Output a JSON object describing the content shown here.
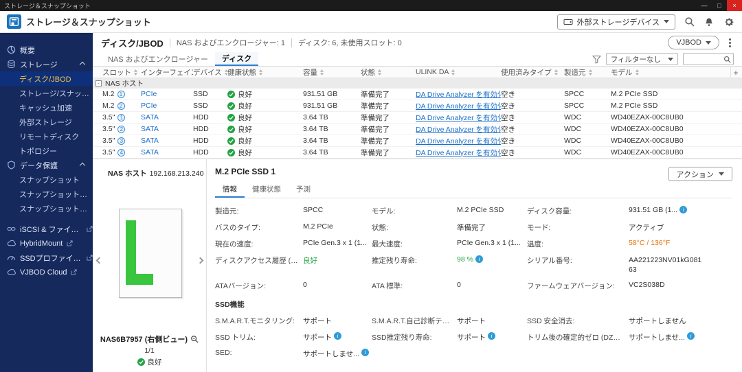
{
  "colors": {
    "titlebar_bg": "#1b1b1b",
    "sidebar_bg": "#16295c",
    "selected_item_text": "#f6c436",
    "accent_blue": "#2b7fd0",
    "link_blue": "#1a6fc9",
    "good_green": "#21a344",
    "temp_orange": "#e8700a",
    "close_red": "#d8231f"
  },
  "titlebar": {
    "title": "ストレージ＆スナップショット",
    "minimize": "—",
    "maximize": "□",
    "close": "×"
  },
  "header": {
    "title": "ストレージ＆スナップショット",
    "external_device_button": "外部ストレージデバイス"
  },
  "sidebar": {
    "overview": "概要",
    "storage_section": "ストレージ",
    "storage_items": [
      "ディスク/JBOD",
      "ストレージ/スナップショ...",
      "キャッシュ加速",
      "外部ストレージ",
      "リモートディスク",
      "トポロジー"
    ],
    "protection_section": "データ保護",
    "protection_items": [
      "スナップショット",
      "スナップショットレプリカ",
      "スナップショットボールト"
    ],
    "external_items": [
      "iSCSI & ファイバー...",
      "HybridMount",
      "SSDプロファイリング...",
      "VJBOD Cloud"
    ]
  },
  "page": {
    "title": "ディスク/JBOD",
    "summary_enclosure": "NAS およびエンクロージャー: 1",
    "summary_disks": "ディスク: 6, 未使用スロット: 0",
    "vjbod_button": "VJBOD"
  },
  "tabs": {
    "enclosure": "NAS およびエンクロージャー",
    "disk": "ディスク",
    "filter": "フィルターなし",
    "add_column": "+"
  },
  "table": {
    "columns": [
      "スロット",
      "インターフェイス",
      "デバイス",
      "健康状態",
      "容量",
      "状態",
      "ULINK DA",
      "使用済みタイプ",
      "製造元",
      "モデル"
    ],
    "group": "NAS ホスト",
    "rows": [
      {
        "slot_type": "M.2",
        "slot_num": "1",
        "iface": "PCIe",
        "device": "SSD",
        "health": "良好",
        "capacity": "931.51 GB",
        "status": "準備完了",
        "ulink": "DA Drive Analyzer を有効化",
        "used": "空き",
        "vendor": "SPCC",
        "model": "M.2 PCIe SSD"
      },
      {
        "slot_type": "M.2",
        "slot_num": "2",
        "iface": "PCIe",
        "device": "SSD",
        "health": "良好",
        "capacity": "931.51 GB",
        "status": "準備完了",
        "ulink": "DA Drive Analyzer を有効化",
        "used": "空き",
        "vendor": "SPCC",
        "model": "M.2 PCIe SSD"
      },
      {
        "slot_type": "3.5\"",
        "slot_num": "1",
        "iface": "SATA",
        "device": "HDD",
        "health": "良好",
        "capacity": "3.64 TB",
        "status": "準備完了",
        "ulink": "DA Drive Analyzer を有効化",
        "used": "空き",
        "vendor": "WDC",
        "model": "WD40EZAX-00C8UB0"
      },
      {
        "slot_type": "3.5\"",
        "slot_num": "2",
        "iface": "SATA",
        "device": "HDD",
        "health": "良好",
        "capacity": "3.64 TB",
        "status": "準備完了",
        "ulink": "DA Drive Analyzer を有効化",
        "used": "空き",
        "vendor": "WDC",
        "model": "WD40EZAX-00C8UB0"
      },
      {
        "slot_type": "3.5\"",
        "slot_num": "3",
        "iface": "SATA",
        "device": "HDD",
        "health": "良好",
        "capacity": "3.64 TB",
        "status": "準備完了",
        "ulink": "DA Drive Analyzer を有効化",
        "used": "空き",
        "vendor": "WDC",
        "model": "WD40EZAX-00C8UB0"
      },
      {
        "slot_type": "3.5\"",
        "slot_num": "4",
        "iface": "SATA",
        "device": "HDD",
        "health": "良好",
        "capacity": "3.64 TB",
        "status": "準備完了",
        "ulink": "DA Drive Analyzer を有効化",
        "used": "空き",
        "vendor": "WDC",
        "model": "WD40EZAX-00C8UB0"
      }
    ]
  },
  "nas_panel": {
    "host_label": "NAS ホスト",
    "host_ip": "192.168.213.240",
    "name": "NAS6B7957 (右側ビュー)",
    "page_indicator": "1/1",
    "health": "良好"
  },
  "detail": {
    "title": "M.2 PCIe SSD 1",
    "action_button": "アクション",
    "tabs": [
      "情報",
      "健康状態",
      "予測"
    ],
    "info_fields": [
      {
        "label": "製造元:",
        "value": "SPCC"
      },
      {
        "label": "モデル:",
        "value": "M.2 PCIe SSD"
      },
      {
        "label": "ディスク容量:",
        "value": "931.51 GB (1..."
      },
      {
        "label": "バスのタイプ:",
        "value": "M.2 PCIe"
      },
      {
        "label": "状態:",
        "value": "準備完了"
      },
      {
        "label": "モード:",
        "value": "アクティブ"
      },
      {
        "label": "現在の速度:",
        "value": "PCIe Gen.3 x 1 (1..."
      },
      {
        "label": "最大速度:",
        "value": "PCIe Gen.3 x 1 (1..."
      },
      {
        "label": "温度:",
        "value": "58°C / 136°F"
      },
      {
        "label": "ディスクアクセス履歴 (I/O):",
        "value": "良好"
      },
      {
        "label": "推定残り寿命:",
        "value": "98 %"
      },
      {
        "label": "シリアル番号:",
        "value": "AA221223NV01kG08163"
      },
      {
        "label": "ATAバージョン:",
        "value": "0"
      },
      {
        "label": "ATA 標準:",
        "value": "0"
      },
      {
        "label": "ファームウェアバージョン:",
        "value": "VC2S038D"
      }
    ],
    "ssd_section": "SSD機能",
    "ssd_fields": [
      {
        "label": "S.M.A.R.T.モニタリング:",
        "value": "サポート"
      },
      {
        "label": "S.M.A.R.T.自己診断テスト:",
        "value": "サポート"
      },
      {
        "label": "SSD 安全消去:",
        "value": "サポートしません"
      },
      {
        "label": "SSD トリム:",
        "value": "サポート"
      },
      {
        "label": "SSD推定残り寿命:",
        "value": "サポート"
      },
      {
        "label": "トリム後の確定的ゼロ (DZAT):",
        "value": "サポートしませ..."
      },
      {
        "label": "SED:",
        "value": "サポートしませ..."
      }
    ]
  }
}
